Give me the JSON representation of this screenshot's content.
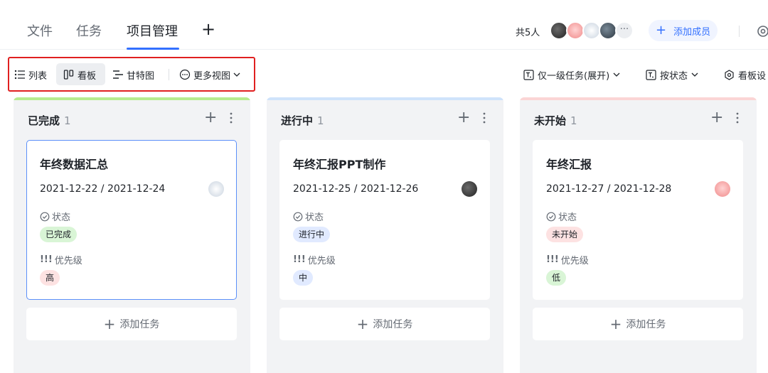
{
  "header": {
    "tabs": [
      {
        "label": "文件",
        "active": false
      },
      {
        "label": "任务",
        "active": false
      },
      {
        "label": "项目管理",
        "active": true
      }
    ],
    "members_count_label": "共5人",
    "more_members": "···",
    "add_member_label": "添加成员",
    "colors": {
      "accent": "#3370ff"
    }
  },
  "toolbar": {
    "views": [
      {
        "label": "列表",
        "icon": "list-icon",
        "active": false
      },
      {
        "label": "看板",
        "icon": "kanban-icon",
        "active": true
      },
      {
        "label": "甘特图",
        "icon": "gantt-icon",
        "active": false
      },
      {
        "label": "更多视图",
        "icon": "more-views-icon",
        "active": false
      }
    ],
    "filter_label": "仅一级任务(展开)",
    "group_label": "按状态",
    "settings_label": "看板设"
  },
  "columns": [
    {
      "title": "已完成",
      "count": "1",
      "stripe_color": "#b7eb8f",
      "card": {
        "title": "年终数据汇总",
        "dates": "2021-12-22 / 2021-12-24",
        "status_label": "状态",
        "status_value": "已完成",
        "status_color": "#d9f5d6",
        "priority_label": "优先级",
        "priority_value": "高",
        "priority_color": "#fde2e2",
        "selected": true
      },
      "add_task_label": "添加任务"
    },
    {
      "title": "进行中",
      "count": "1",
      "stripe_color": "#cfe3fb",
      "card": {
        "title": "年终汇报PPT制作",
        "dates": "2021-12-25 / 2021-12-26",
        "status_label": "状态",
        "status_value": "进行中",
        "status_color": "#e1eaff",
        "priority_label": "优先级",
        "priority_value": "中",
        "priority_color": "#e1eaff",
        "selected": false
      },
      "add_task_label": "添加任务"
    },
    {
      "title": "未开始",
      "count": "1",
      "stripe_color": "#fbd5d5",
      "card": {
        "title": "年终汇报",
        "dates": "2021-12-27 / 2021-12-28",
        "status_label": "状态",
        "status_value": "未开始",
        "status_color": "#fde2e2",
        "priority_label": "优先级",
        "priority_value": "低",
        "priority_color": "#d9f5d6",
        "selected": false
      },
      "add_task_label": "添加任务"
    }
  ]
}
